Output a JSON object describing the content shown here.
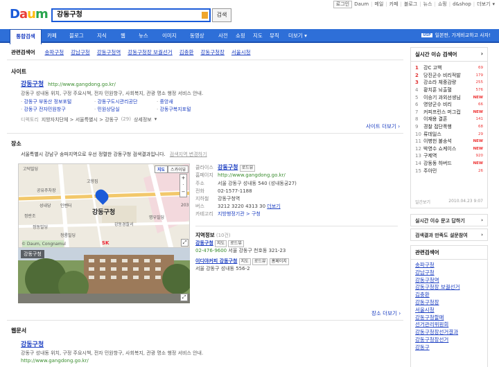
{
  "topbar": {
    "login": "로그인",
    "items": [
      "Daum",
      "메일",
      "카페",
      "블로그",
      "뉴스",
      "쇼핑",
      "d&shop",
      "더보기"
    ]
  },
  "logo": {
    "d": "D",
    "a": "a",
    "u": "u",
    "m": "m"
  },
  "search": {
    "query": "강동구청",
    "button": "검색"
  },
  "nav": {
    "tabs": [
      "통합검색",
      "카페",
      "블로그",
      "지식",
      "웹",
      "뉴스",
      "이미지",
      "동영상",
      "사전",
      "쇼핑",
      "지도",
      "뮤직",
      "더보기"
    ],
    "right": "일본판, 가게비교하고 사자!",
    "right_icon": "USP"
  },
  "related": {
    "title": "관련검색어",
    "items": [
      "송파구청",
      "강남구청",
      "강동구청역",
      "강동구청장 보궐선거",
      "김충환",
      "강동구청장",
      "서울시청"
    ]
  },
  "site": {
    "section": "사이트",
    "title": "강동구청",
    "url": "http://www.gangdong.go.kr/",
    "desc": "강동구 성내동 위치, 구정 주요시책, 전자 민원항구, 사회복지, 관광 명소 행정 서비스 안내.",
    "links": [
      [
        "강동구 부동산 정보포털",
        "강동구도시관리공단",
        "중앙새"
      ],
      [
        "강동구 전자민원창구",
        "민원상담실",
        "강동구복지포털"
      ]
    ],
    "dir_label": "디렉토리",
    "dir": "지방자치단체 > 서울특별시 > 강동구",
    "dir_count": "(29)",
    "dir_more": "상세정보",
    "more": "사이트 더보기"
  },
  "place": {
    "section": "장소",
    "desc": "서울특별시 강남구 송파지역으로 우선 정렬한 강동구청 검색결과입니다.",
    "change": "검색지역 변경하기",
    "map_btn_map": "지도",
    "map_btn_sky": "스카이뷰",
    "map_label": "강동구청",
    "map_places": [
      "고덕빌딩",
      "공유주차장",
      "고향집",
      "성내당",
      "인벤터",
      "정란조",
      "강동구청",
      "강동경찰서",
      "명우빌딩",
      "정동빌딩",
      "청룡빌딩",
      "SK",
      "203"
    ],
    "map_copy": "© Daum, Congnamul",
    "photo_label": "강동구청"
  },
  "info": {
    "category_k": "클라이스",
    "name": "강동구청",
    "road": "로드뷰",
    "home_k": "홈페이지",
    "home": "http://www.gangdong.go.kr/",
    "addr_k": "주소",
    "addr": "서울 강동구 성내동 540 (성내동궁27)",
    "tel_k": "전화",
    "tel": "02-1577-1188",
    "sub_k": "지하철",
    "sub": "강동구청역",
    "bus_k": "버스",
    "bus": "3212  3220  4313  30",
    "bus_more": "더보기",
    "cat_k": "카테고리",
    "cat": "지방행정기관 > 구청"
  },
  "area": {
    "title": "지역정보",
    "count": "(10건)",
    "items": [
      {
        "name": "강동구청",
        "btn1": "지도",
        "btn2": "로드뷰",
        "tel": "02-476-9600",
        "addr": "서울 강동구 천호동 321-23"
      },
      {
        "name": "이디야커피 강동구청",
        "btn1": "지도",
        "btn2": "로드뷰",
        "btn3": "홈페이지",
        "addr": "서울 강동구 성내동 556-2"
      }
    ],
    "more": "장소 더보기"
  },
  "web": {
    "section": "웹문서",
    "title": "강동구청",
    "desc": "강동구 성내동 위치, 구정 주요시책, 전자 민원항구, 사회복지, 관광 명소 행정 서비스 안내.",
    "url": "http://www.gangdong.go.kr/"
  },
  "ranking": {
    "title": "실시간 이슈 검색어",
    "items": [
      {
        "n": "1",
        "w": "강C 고백",
        "c": "69"
      },
      {
        "n": "2",
        "w": "당진군수 비리적발",
        "c": "179"
      },
      {
        "n": "3",
        "w": "강소라 체중감량",
        "c": "255"
      },
      {
        "n": "4",
        "w": "황치훈 뇌출혈",
        "c": "576"
      },
      {
        "n": "5",
        "w": "이승기 과외선생님",
        "c": "NEW"
      },
      {
        "n": "6",
        "w": "영양군수 비리",
        "c": "66"
      },
      {
        "n": "7",
        "w": "커피프린스 머그컵",
        "c": "NEW"
      },
      {
        "n": "8",
        "w": "이재용 결혼",
        "c": "141"
      },
      {
        "n": "9",
        "w": "경찰 접단폭행",
        "c": "68"
      },
      {
        "n": "10",
        "w": "류데일스",
        "c": "29"
      },
      {
        "n": "11",
        "w": "이병헌 불송석",
        "c": "NEW"
      },
      {
        "n": "12",
        "w": "박영수 쇼케이스",
        "c": "NEW"
      },
      {
        "n": "13",
        "w": "구제역",
        "c": "920"
      },
      {
        "n": "14",
        "w": "강동동 하버드",
        "c": "NEW"
      },
      {
        "n": "15",
        "w": "주아민",
        "c": "26"
      }
    ],
    "footer_l": "일간보기",
    "footer_r": "2010.04.23 9:07"
  },
  "side_buttons": {
    "b1": "실시간 이슈 문고 답하기",
    "b2": "검색결과 만족도 설문참여"
  },
  "side_related": {
    "title": "관련검색어",
    "items": [
      "송파구청",
      "강남구청",
      "강동구청역",
      "강동구청장 보궐선거",
      "김충환",
      "강동구청장",
      "서울시청",
      "강동구청할매",
      "선거관리위원회",
      "강동구청장선거결과",
      "강동구청장선거",
      "강동구"
    ]
  }
}
